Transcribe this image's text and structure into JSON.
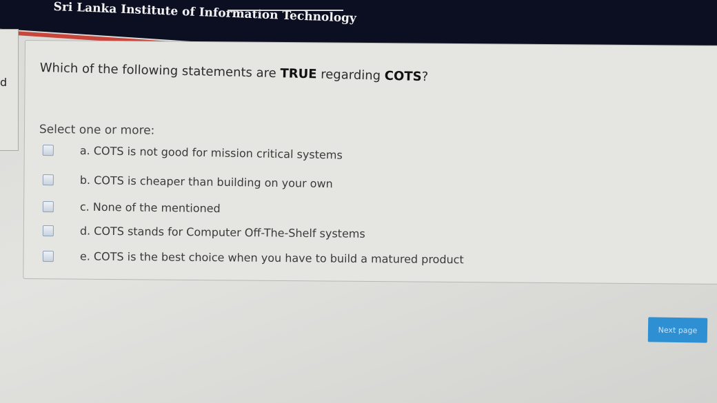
{
  "header": {
    "brand": "Sri Lanka Institute of Information Technology",
    "side_glyph": "d"
  },
  "question": {
    "text_prefix": "Which of the following statements are ",
    "text_bold1": "TRUE",
    "text_mid": " regarding ",
    "text_bold2": "COTS",
    "text_suffix": "?",
    "prompt": "Select one or more:",
    "options": [
      {
        "label": "a. COTS is not good for mission critical systems",
        "checked": false
      },
      {
        "label": "b. COTS is cheaper than building on your own",
        "checked": false
      },
      {
        "label": "c. None of the mentioned",
        "checked": false
      },
      {
        "label": "d. COTS stands for Computer Off-The-Shelf systems",
        "checked": false
      },
      {
        "label": "e. COTS is the best choice when you have to build a matured product",
        "checked": false
      }
    ]
  },
  "navigation": {
    "next_label": "Next page"
  },
  "colors": {
    "header_bg": "#0c0f22",
    "header_stripe": "#c8453c",
    "button_bg": "#2f8fd3"
  }
}
